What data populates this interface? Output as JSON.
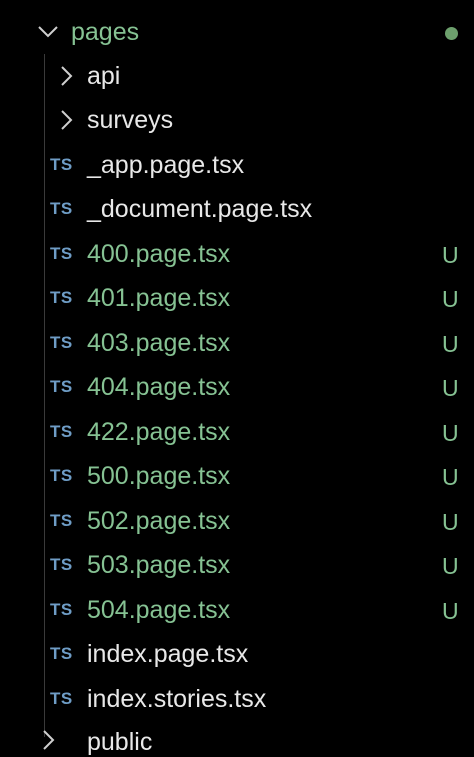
{
  "explorer": {
    "root_folder": {
      "label": "pages",
      "expanded": true,
      "status_color": "#6c9f6c"
    },
    "subfolders": [
      {
        "label": "api",
        "expanded": false
      },
      {
        "label": "surveys",
        "expanded": false
      }
    ],
    "files": [
      {
        "icon": "TS",
        "label": "_app.page.tsx",
        "status": ""
      },
      {
        "icon": "TS",
        "label": "_document.page.tsx",
        "status": ""
      },
      {
        "icon": "TS",
        "label": "400.page.tsx",
        "status": "U"
      },
      {
        "icon": "TS",
        "label": "401.page.tsx",
        "status": "U"
      },
      {
        "icon": "TS",
        "label": "403.page.tsx",
        "status": "U"
      },
      {
        "icon": "TS",
        "label": "404.page.tsx",
        "status": "U"
      },
      {
        "icon": "TS",
        "label": "422.page.tsx",
        "status": "U"
      },
      {
        "icon": "TS",
        "label": "500.page.tsx",
        "status": "U"
      },
      {
        "icon": "TS",
        "label": "502.page.tsx",
        "status": "U"
      },
      {
        "icon": "TS",
        "label": "503.page.tsx",
        "status": "U"
      },
      {
        "icon": "TS",
        "label": "504.page.tsx",
        "status": "U"
      },
      {
        "icon": "TS",
        "label": "index.page.tsx",
        "status": ""
      },
      {
        "icon": "TS",
        "label": "index.stories.tsx",
        "status": ""
      }
    ],
    "next_item_partial": {
      "label": "public"
    }
  },
  "colors": {
    "background": "#000000",
    "text": "#e8e8e8",
    "untracked": "#86c293",
    "ts_icon": "#6f9dc6"
  }
}
